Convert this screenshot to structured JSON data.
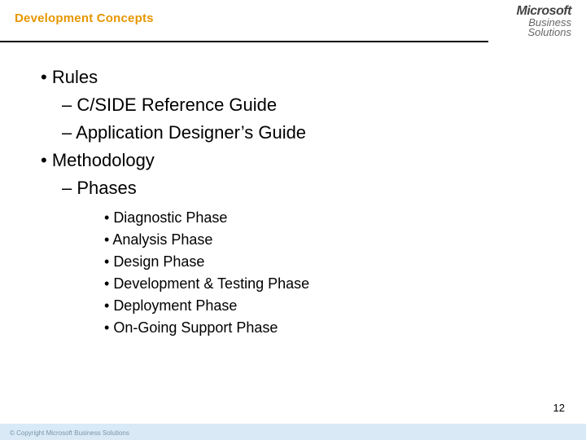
{
  "title": "Development Concepts",
  "logo": {
    "line1": "Microsoft",
    "line2": "Business",
    "line3": "Solutions"
  },
  "bullets": {
    "rules": "Rules",
    "cside": "C/SIDE Reference Guide",
    "adg": "Application Designer’s Guide",
    "methodology": "Methodology",
    "phases": "Phases",
    "phase_list": [
      "Diagnostic Phase",
      "Analysis Phase",
      "Design Phase",
      "Development & Testing Phase",
      "Deployment Phase",
      "On-Going Support Phase"
    ]
  },
  "page_number": "12",
  "copyright": "© Copyright Microsoft Business Solutions"
}
